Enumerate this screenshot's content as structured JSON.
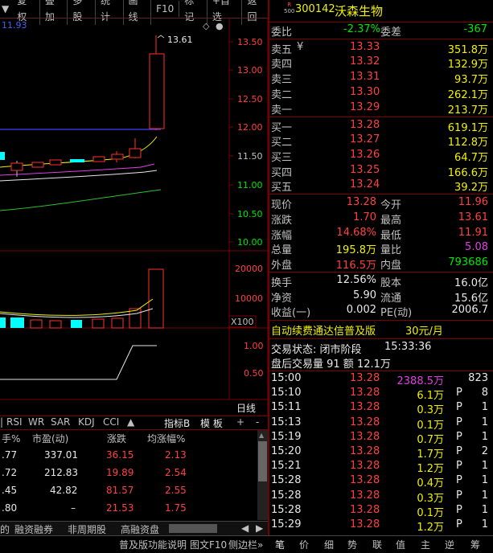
{
  "toolbar": [
    "复权",
    "叠加",
    "多股",
    "统计",
    "画线",
    "F10",
    "标记",
    "+自选",
    "返回"
  ],
  "toolbar_left_icon": "dropdown-arrow",
  "chart": {
    "top_value": "11.93",
    "high_marker": "13.61",
    "price_axis": [
      "13.50",
      "13.00",
      "12.50",
      "12.00",
      "11.50",
      "11.00",
      "10.50",
      "10.00"
    ],
    "volume_axis": [
      "20000",
      "10000"
    ],
    "volume_unit": "X100",
    "indicator_axis": [
      "1.00",
      "0.50"
    ],
    "indicator_label": "日线",
    "tabs": [
      "RSI",
      "WR",
      "SAR",
      "KDJ",
      "CCI"
    ],
    "tab_controls": [
      "指标B",
      "模 板",
      "+",
      "-"
    ],
    "colors": {
      "up": "#ff3030",
      "cyan": "#00ffff",
      "ma_yellow": "#f0f000",
      "ma_magenta": "#e040e0",
      "ma_green": "#30c030",
      "ma_blue": "#4040ff"
    }
  },
  "table": {
    "headers": [
      "手%",
      "市盈(动)",
      "涨跌",
      "均涨幅%"
    ],
    "rows": [
      {
        "a": ".77",
        "b": "337.01",
        "c": "36.15",
        "d": "2.13"
      },
      {
        "a": ".72",
        "b": "212.83",
        "c": "19.89",
        "d": "2.54"
      },
      {
        "a": ".45",
        "b": "42.82",
        "c": "81.57",
        "d": "2.55"
      },
      {
        "a": ".80",
        "b": "–",
        "c": "21.53",
        "d": "1.75"
      }
    ],
    "bottom_tabs": [
      "的",
      "融资融券",
      "非周期股",
      "高融资盘"
    ]
  },
  "statusbar": {
    "left": "普及版功能说明",
    "mid": "图文F10",
    "right": "侧边栏»"
  },
  "stock": {
    "badge_top": "R",
    "badge_bottom": "500",
    "code": "300142",
    "name": "沃森生物"
  },
  "weibi": {
    "label": "委比",
    "pct": "-2.37%",
    "label2": "委差",
    "val": "-367"
  },
  "sell": [
    {
      "label": "卖五",
      "mark": "¥",
      "price": "13.33",
      "vol": "351.8万"
    },
    {
      "label": "卖四",
      "price": "13.32",
      "vol": "132.9万"
    },
    {
      "label": "卖三",
      "price": "13.31",
      "vol": "93.7万"
    },
    {
      "label": "卖二",
      "price": "13.30",
      "vol": "262.1万"
    },
    {
      "label": "卖一",
      "price": "13.29",
      "vol": "213.7万"
    }
  ],
  "buy": [
    {
      "label": "买一",
      "price": "13.28",
      "vol": "619.1万"
    },
    {
      "label": "买二",
      "price": "13.27",
      "vol": "112.8万"
    },
    {
      "label": "买三",
      "price": "13.26",
      "vol": "64.7万"
    },
    {
      "label": "买四",
      "price": "13.25",
      "vol": "166.6万"
    },
    {
      "label": "买五",
      "price": "13.24",
      "vol": "39.2万"
    }
  ],
  "quote": [
    {
      "l1": "现价",
      "v1": "13.28",
      "l2": "今开",
      "v2": "11.96",
      "c2": "red"
    },
    {
      "l1": "涨跌",
      "v1": "1.70",
      "l2": "最高",
      "v2": "13.61",
      "c2": "red"
    },
    {
      "l1": "涨幅",
      "v1": "14.68%",
      "l2": "最低",
      "v2": "11.91",
      "c2": "red"
    },
    {
      "l1": "总量",
      "v1": "195.8万",
      "l2": "量比",
      "v2": "5.08",
      "c2": "magenta",
      "c1": "yellow"
    },
    {
      "l1": "外盘",
      "v1": "116.5万",
      "l2": "内盘",
      "v2": "793686",
      "c2": "green"
    }
  ],
  "fund": [
    {
      "l1": "换手",
      "v1": "12.56%",
      "l2": "股本",
      "v2": "16.0亿"
    },
    {
      "l1": "净资",
      "v1": "5.90",
      "l2": "流通",
      "v2": "15.6亿"
    },
    {
      "l1": "收益(一)",
      "v1": "0.002",
      "l2": "PE(动)",
      "v2": "2006.7"
    }
  ],
  "promo": {
    "text": "自动续费通达信普及版",
    "price": "30元/月"
  },
  "trade_status": {
    "label": "交易状态: 闭市阶段",
    "time": "15:33:36"
  },
  "after_hours": "盘后交易量 91 额 12.1万",
  "ticks": [
    {
      "t": "15:00",
      "p": "13.28",
      "v": "2388.5万",
      "f": "",
      "n": "823",
      "vc": "magenta"
    },
    {
      "t": "15:10",
      "p": "13.28",
      "v": "6.1万",
      "f": "P",
      "n": "8"
    },
    {
      "t": "15:11",
      "p": "13.28",
      "v": "0.3万",
      "f": "P",
      "n": "1"
    },
    {
      "t": "15:13",
      "p": "13.28",
      "v": "0.1万",
      "f": "P",
      "n": "1"
    },
    {
      "t": "15:19",
      "p": "13.28",
      "v": "0.7万",
      "f": "P",
      "n": "1"
    },
    {
      "t": "15:20",
      "p": "13.28",
      "v": "1.7万",
      "f": "P",
      "n": "2"
    },
    {
      "t": "15:21",
      "p": "13.28",
      "v": "1.2万",
      "f": "P",
      "n": "1"
    },
    {
      "t": "15:28",
      "p": "13.28",
      "v": "0.4万",
      "f": "P",
      "n": "1"
    },
    {
      "t": "15:28",
      "p": "13.28",
      "v": "0.3万",
      "f": "P",
      "n": "1"
    },
    {
      "t": "15:28",
      "p": "13.28",
      "v": "0.1万",
      "f": "P",
      "n": "1"
    },
    {
      "t": "15:29",
      "p": "13.28",
      "v": "1.2万",
      "f": "P",
      "n": "1"
    }
  ],
  "bottom_tabs_right": [
    "笔",
    "价",
    "细",
    "势",
    "联",
    "值",
    "主",
    "逆",
    "筹"
  ]
}
